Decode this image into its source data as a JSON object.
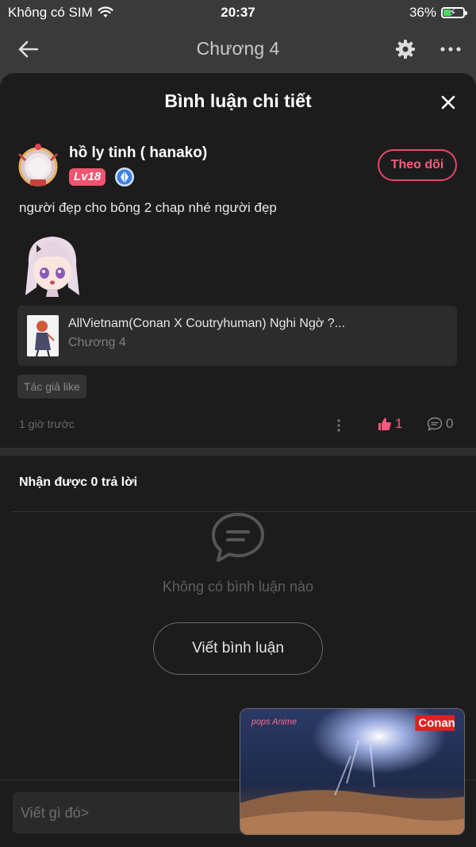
{
  "status_bar": {
    "carrier": "Không có SIM",
    "time": "20:37",
    "battery": "36%",
    "battery_level": 0.36
  },
  "app_header": {
    "title": "Chương 4"
  },
  "sheet": {
    "title": "Bình luận chi tiết",
    "comment": {
      "username": "hồ ly tinh ( hanako)",
      "level": "Lv18",
      "follow_label": "Theo dõi",
      "text": "người đẹp cho bông 2 chap nhé người đẹp",
      "story": {
        "title": "AllVietnam(Conan X Coutryhuman) Nghi Ngờ ?...",
        "chapter": "Chương 4"
      },
      "tag": "Tác giả like",
      "time_ago": "1 giờ trước",
      "likes": "1",
      "replies": "0"
    },
    "replies_header": "Nhận được 0 trả lời",
    "empty_text": "Không có bình luận nào",
    "write_button": "Viết bình luận",
    "input_placeholder": "Viết gì đó>"
  },
  "video_overlay": {
    "logo_left": "pops Anime",
    "logo_right": "Conan"
  },
  "colors": {
    "accent": "#ff5a7e",
    "background": "#1c1c1c",
    "header": "#3a3a3a"
  }
}
